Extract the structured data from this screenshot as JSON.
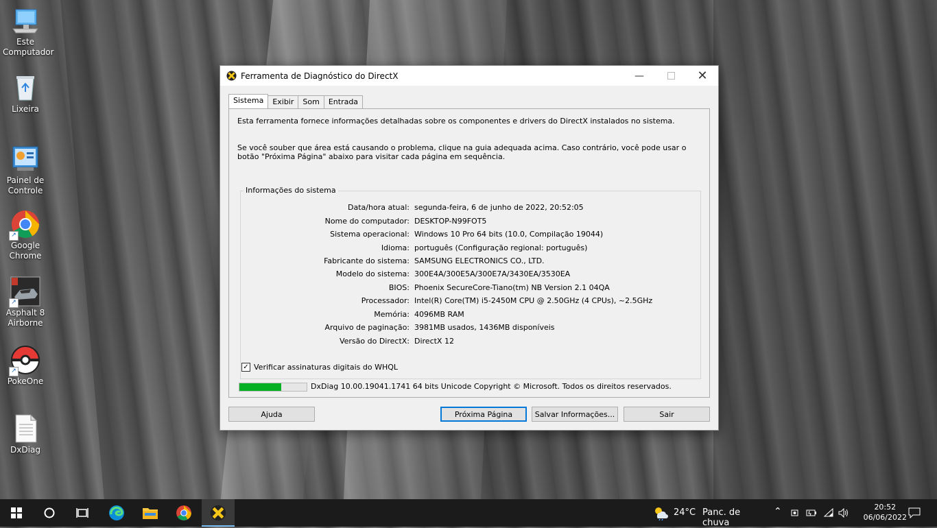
{
  "desktop": {
    "icons": [
      {
        "label1": "Este",
        "label2": "Computador",
        "icon": "computer-icon"
      },
      {
        "label1": "Lixeira",
        "label2": "",
        "icon": "recycle-bin-icon"
      },
      {
        "label1": "Painel de",
        "label2": "Controle",
        "icon": "control-panel-icon"
      },
      {
        "label1": "Google",
        "label2": "Chrome",
        "icon": "chrome-icon"
      },
      {
        "label1": "Asphalt 8",
        "label2": "Airborne",
        "icon": "asphalt-icon"
      },
      {
        "label1": "PokeOne",
        "label2": "",
        "icon": "pokeball-icon"
      },
      {
        "label1": "DxDiag",
        "label2": "",
        "icon": "document-icon"
      }
    ]
  },
  "dialog": {
    "title": "Ferramenta de Diagnóstico do DirectX",
    "tabs": [
      "Sistema",
      "Exibir",
      "Som",
      "Entrada"
    ],
    "active_tab": "Sistema",
    "intro1": "Esta ferramenta fornece informações detalhadas sobre os componentes e drivers do DirectX instalados no sistema.",
    "intro2": "Se você souber que área está causando o problema, clique na guia adequada acima. Caso contrário, você pode usar o botão \"Próxima Página\" abaixo para visitar cada página em sequência.",
    "group_label": "Informações do sistema",
    "info": [
      {
        "label": "Data/hora atual:",
        "value": "segunda-feira, 6 de junho de 2022, 20:52:05"
      },
      {
        "label": "Nome do computador:",
        "value": "DESKTOP-N99FOT5"
      },
      {
        "label": "Sistema operacional:",
        "value": "Windows 10 Pro 64 bits (10.0, Compilação 19044)"
      },
      {
        "label": "Idioma:",
        "value": "português (Configuração regional: português)"
      },
      {
        "label": "Fabricante do sistema:",
        "value": "SAMSUNG ELECTRONICS CO., LTD."
      },
      {
        "label": "Modelo do sistema:",
        "value": "300E4A/300E5A/300E7A/3430EA/3530EA"
      },
      {
        "label": "BIOS:",
        "value": "Phoenix SecureCore-Tiano(tm) NB Version 2.1 04QA"
      },
      {
        "label": "Processador:",
        "value": "Intel(R) Core(TM) i5-2450M CPU @ 2.50GHz (4 CPUs), ~2.5GHz"
      },
      {
        "label": "Memória:",
        "value": "4096MB RAM"
      },
      {
        "label": "Arquivo de paginação:",
        "value": "3981MB usados, 1436MB disponíveis"
      },
      {
        "label": "Versão do DirectX:",
        "value": "DirectX 12"
      }
    ],
    "whql_checkbox": {
      "label": "Verificar assinaturas digitais do WHQL",
      "checked": true
    },
    "progress_fraction": 0.62,
    "status_text": "DxDiag 10.00.19041.1741 64 bits Unicode  Copyright © Microsoft. Todos os direitos reservados.",
    "buttons": {
      "help": "Ajuda",
      "next": "Próxima Página",
      "save": "Salvar Informações...",
      "exit": "Sair"
    }
  },
  "taskbar": {
    "apps": [
      "start-icon",
      "search-icon",
      "task-view-icon",
      "edge-icon",
      "file-explorer-icon",
      "chrome-icon",
      "directx-icon"
    ],
    "weather_temp": "24°C",
    "weather_text": "Panc. de chuva",
    "time": "20:52",
    "date": "06/06/2022"
  },
  "colors": {
    "progress_green": "#06b025",
    "accent": "#0078d7"
  }
}
